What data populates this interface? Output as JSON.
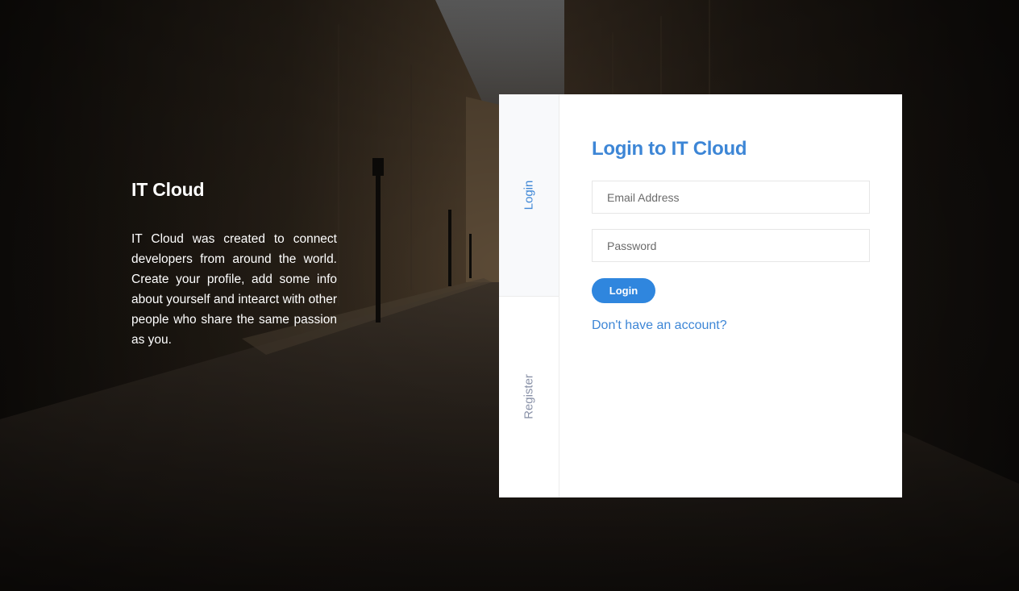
{
  "intro": {
    "title": "IT Cloud",
    "text": "IT Cloud was created to connect developers from around the world. Create your profile, add some info about yourself and intearct with other people who share the same passion as you."
  },
  "tabs": [
    {
      "label": "Login",
      "active": true
    },
    {
      "label": "Register",
      "active": false
    }
  ],
  "form": {
    "title": "Login to IT Cloud",
    "email_placeholder": "Email Address",
    "email_value": "",
    "password_placeholder": "Password",
    "password_value": "",
    "submit_label": "Login",
    "switch_link": "Don't have an account?"
  },
  "colors": {
    "accent": "#3d86d6",
    "button": "#2f86de",
    "inactive_tab": "#8a92a8",
    "background": "#171310"
  }
}
